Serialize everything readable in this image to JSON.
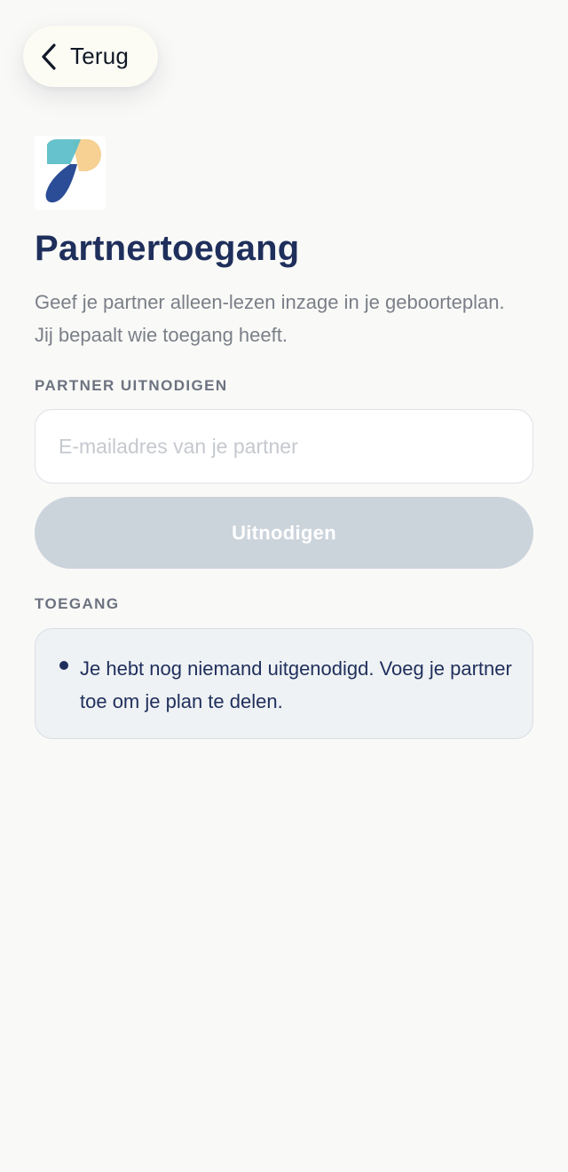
{
  "header": {
    "back_label": "Terug",
    "back_icon": "chevron-left-icon"
  },
  "brand": {
    "logo_icon": "app-logo",
    "colors": {
      "teal": "#5ebfc9",
      "peach": "#f6d193",
      "navy": "#2b4c96"
    }
  },
  "main": {
    "title": "Partnertoegang",
    "subtitle": "Geef je partner alleen-lezen inzage in je geboorteplan. Jij bepaalt wie toegang heeft."
  },
  "invite": {
    "section_label": "PARTNER UITNODIGEN",
    "email_value": "",
    "email_placeholder": "E-mailadres van je partner",
    "button_label": "Uitnodigen"
  },
  "access": {
    "section_label": "TOEGANG",
    "empty_message": "Je hebt nog niemand uitgenodigd. Voeg je partner toe om je plan te delen."
  },
  "colors": {
    "background": "#f9f9f7",
    "primary_text": "#1f2f5c",
    "muted_text": "#7a7f88",
    "disabled_button": "#cbd3db",
    "card_background": "#eff2f4"
  }
}
